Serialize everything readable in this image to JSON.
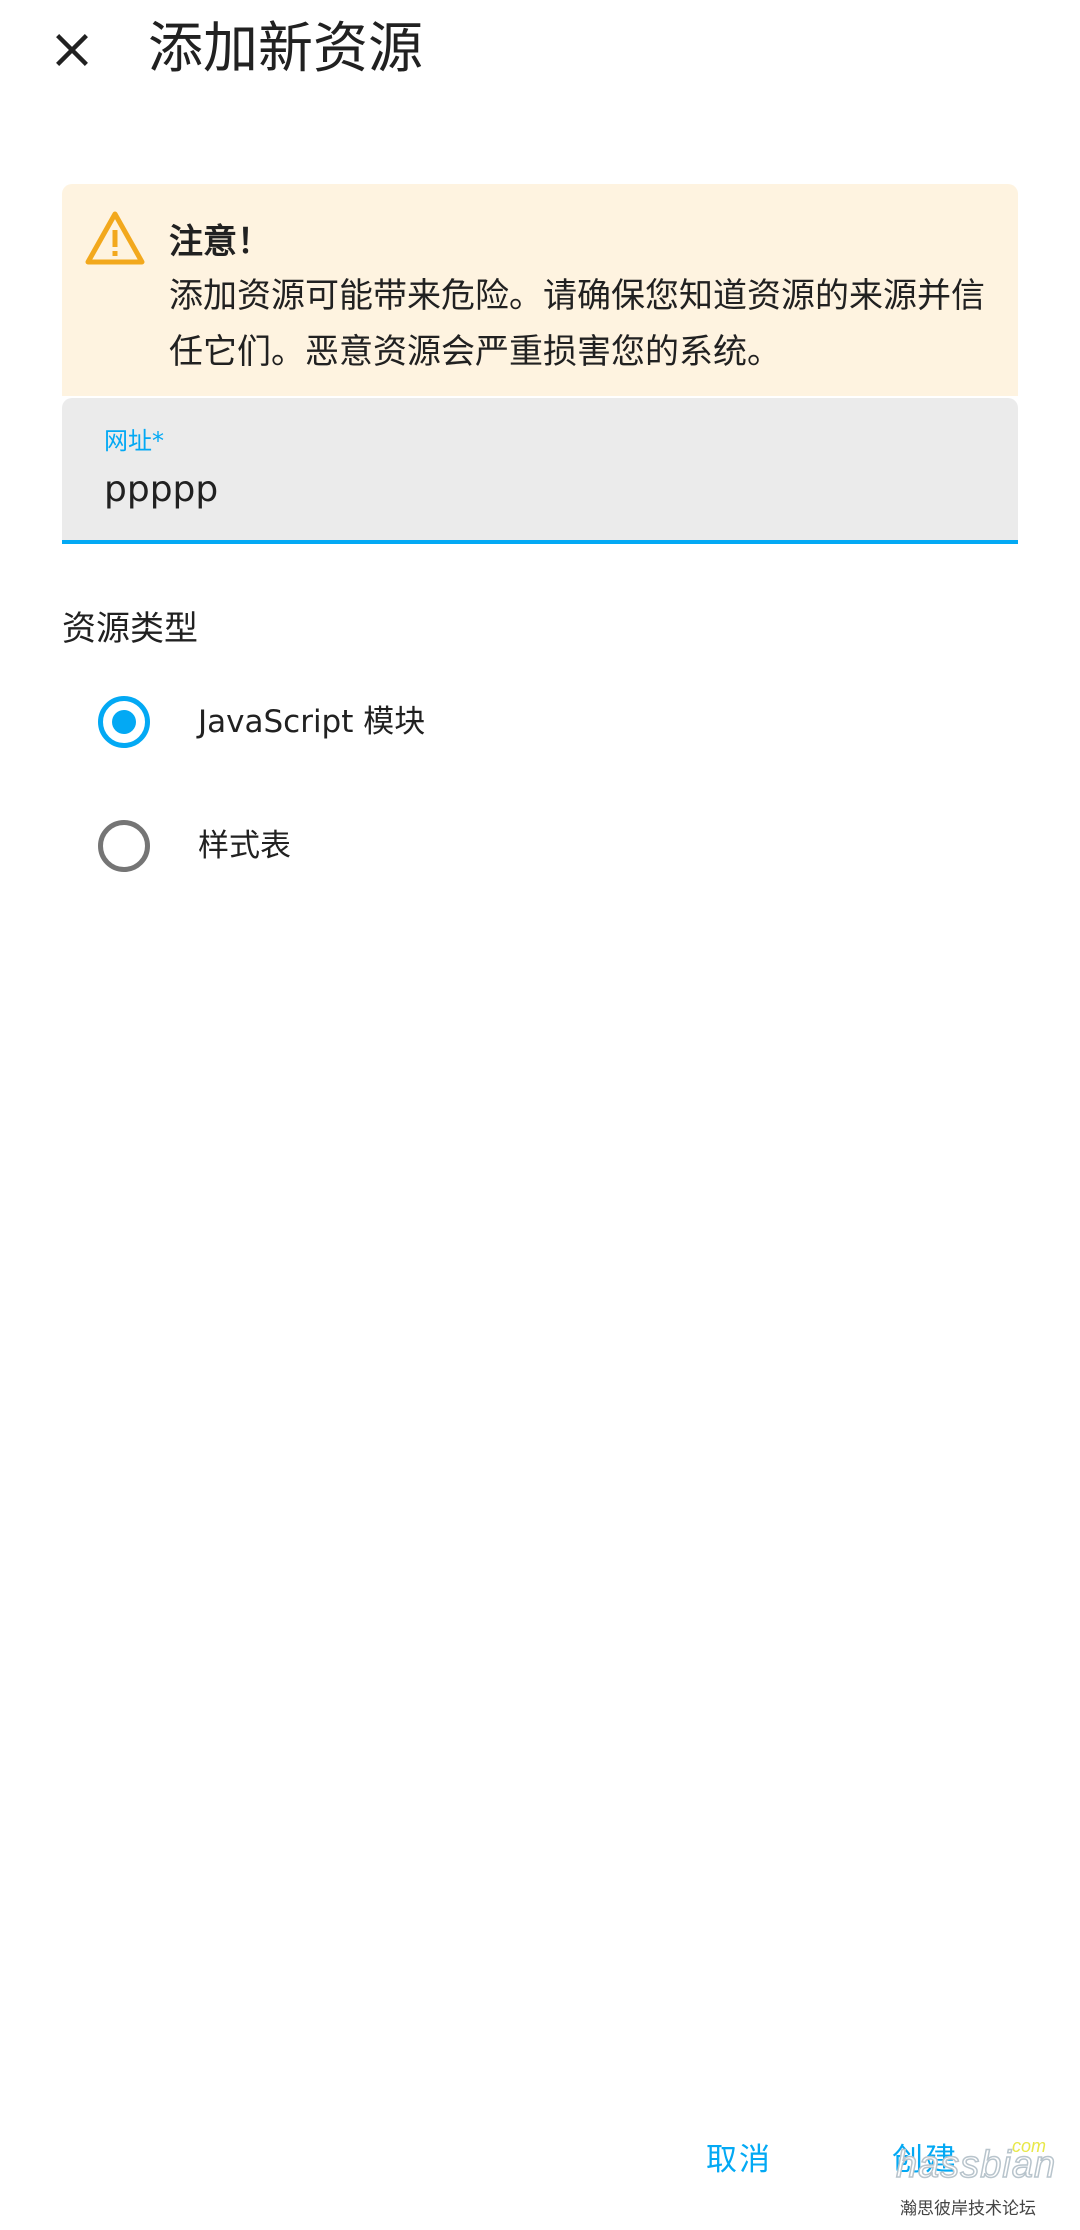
{
  "header": {
    "close_icon": "close-icon",
    "title": "添加新资源"
  },
  "alert": {
    "icon": "warning-icon",
    "icon_color": "#f2a81d",
    "background": "#fef3e0",
    "title": "注意！",
    "message": "添加资源可能带来危险。请确保您知道资源的来源并信任它们。恶意资源会严重损害您的系统。"
  },
  "url_field": {
    "label": "网址*",
    "value": "ppppp",
    "accent_color": "#03a9f4"
  },
  "resource_type": {
    "label": "资源类型",
    "options": [
      {
        "label": "JavaScript 模块",
        "selected": true
      },
      {
        "label": "样式表",
        "selected": false
      }
    ]
  },
  "actions": {
    "cancel_label": "取消",
    "create_label": "创建"
  },
  "watermark": {
    "brand": "hassbian",
    "suffix": ".com",
    "subtitle": "瀚思彼岸技术论坛"
  }
}
